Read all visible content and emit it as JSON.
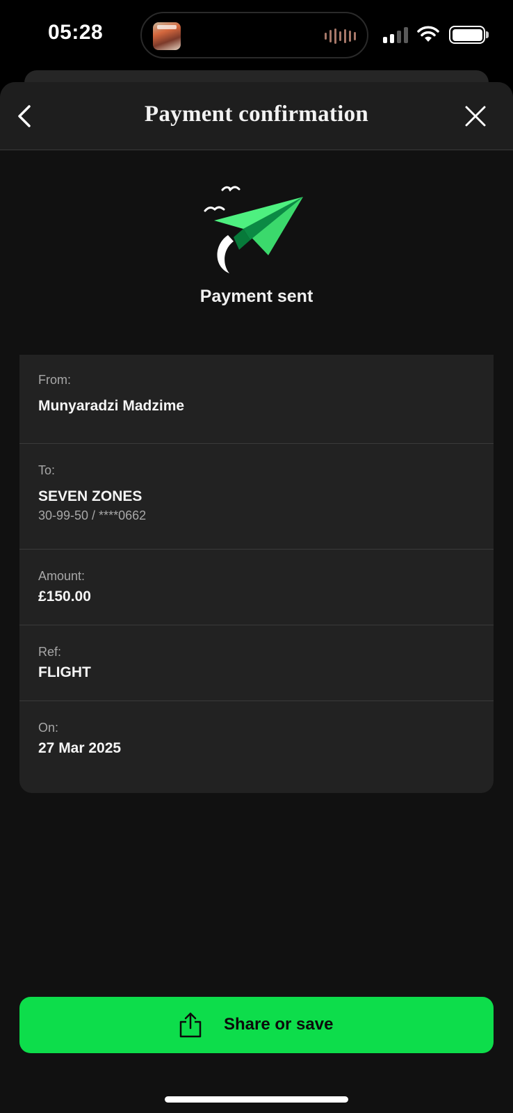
{
  "status_bar": {
    "time": "05:28",
    "battery_level": 1.0,
    "signal_bars": 2,
    "icons": [
      "now-playing-art",
      "waveform-icon",
      "signal-icon",
      "wifi-icon",
      "battery-icon"
    ]
  },
  "header": {
    "title": "Payment confirmation",
    "back_icon": "chevron-left-icon",
    "close_icon": "close-icon"
  },
  "confirmation": {
    "illustration_icon": "paper-plane-icon",
    "status": "Payment sent"
  },
  "details": {
    "from_label": "From:",
    "from_value": "Munyaradzi Madzime",
    "to_label": "To:",
    "to_value": "SEVEN ZONES",
    "to_account": "30-99-50 / ****0662",
    "amount_label": "Amount:",
    "amount_value": "£150.00",
    "ref_label": "Ref:",
    "ref_value": "FLIGHT",
    "on_label": "On:",
    "on_value": "27 Mar 2025"
  },
  "actions": {
    "share_label": "Share or save",
    "share_icon": "share-icon"
  },
  "colors": {
    "accent": "#0ddd4b",
    "plane_light": "#4ef080",
    "plane_dark": "#0b8a44",
    "background": "#111111",
    "card": "#222222"
  }
}
